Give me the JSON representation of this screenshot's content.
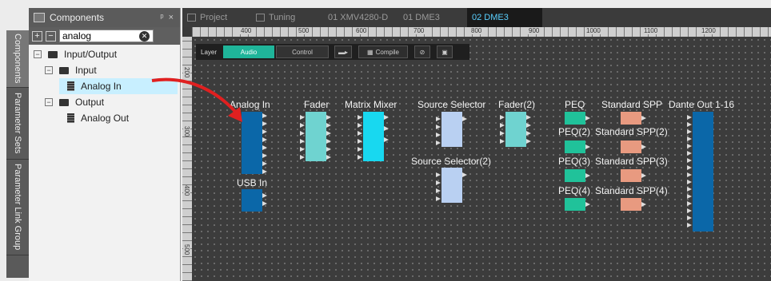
{
  "side_tabs": [
    "Components",
    "Parameter Sets",
    "Parameter Link Group"
  ],
  "panel": {
    "title": "Components",
    "pin": "ᵖ",
    "close": "×",
    "search_value": "analog",
    "tree": {
      "root": "Input/Output",
      "input": "Input",
      "analog_in": "Analog In",
      "output": "Output",
      "analog_out": "Analog Out"
    }
  },
  "tabs": [
    "Project",
    "Tuning",
    "01 XMV4280-D",
    "01 DME3",
    "02 DME3"
  ],
  "active_tab": "02 DME3",
  "ruler": {
    "h": [
      "400",
      "500",
      "600",
      "700",
      "800",
      "900",
      "1000",
      "1100",
      "1200"
    ],
    "v": [
      "200",
      "300",
      "400",
      "500"
    ]
  },
  "toolbar": {
    "layer": "Layer",
    "audio": "Audio",
    "control": "Control",
    "compile": "Compile"
  },
  "blocks": {
    "analog_in": "Analog In",
    "usb_in": "USB In",
    "fader": "Fader",
    "matrix_mixer": "Matrix Mixer",
    "source_selector": "Source Selector",
    "source_selector_2": "Source Selector(2)",
    "fader_2": "Fader(2)",
    "peq": "PEQ",
    "peq_2": "PEQ(2)",
    "peq_3": "PEQ(3)",
    "peq_4": "PEQ(4)",
    "standard_spp": "Standard SPP",
    "standard_spp_2": "Standard SPP(2)",
    "standard_spp_3": "Standard SPP(3)",
    "standard_spp_4": "Standard SPP(4)",
    "dante_out": "Dante Out 1-16"
  },
  "colors": {
    "analog_in": "#0b67a8",
    "usb_in": "#0b67a8",
    "fader": "#6fd3d0",
    "matrix_mixer": "#18d8f0",
    "source_selector": "#b9d0f2",
    "peq": "#20c29a",
    "standard_spp": "#e89a80",
    "dante_out": "#0b67a8",
    "drag_arrow": "#e02020",
    "active_tab_text": "#5ad0ff"
  }
}
